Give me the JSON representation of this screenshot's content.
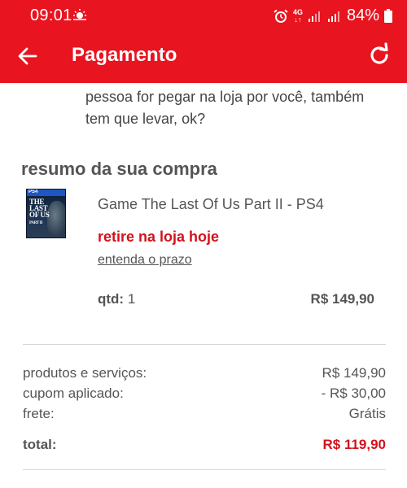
{
  "status_bar": {
    "time": "09:01",
    "network": "4G",
    "battery": "84%"
  },
  "app_bar": {
    "title": "Pagamento"
  },
  "note": {
    "text": "pessoa for pegar na loja por você, também tem que levar, ok?"
  },
  "summary": {
    "title": "resumo da sua compra",
    "product": {
      "name": "Game The Last Of Us Part II - PS4",
      "pickup": "retire na loja hoje",
      "deadline_link": "entenda o prazo",
      "qty_label": "qtd:",
      "qty_value": "1",
      "price": "R$ 149,90"
    },
    "rows": [
      {
        "label": "produtos e serviços:",
        "value": "R$ 149,90"
      },
      {
        "label": "cupom aplicado:",
        "value": "- R$ 30,00"
      },
      {
        "label": "frete:",
        "value": "Grátis"
      }
    ],
    "total": {
      "label": "total:",
      "value": "R$ 119,90"
    }
  },
  "colors": {
    "brand_red": "#e8141f",
    "accent_red": "#d3121c"
  }
}
